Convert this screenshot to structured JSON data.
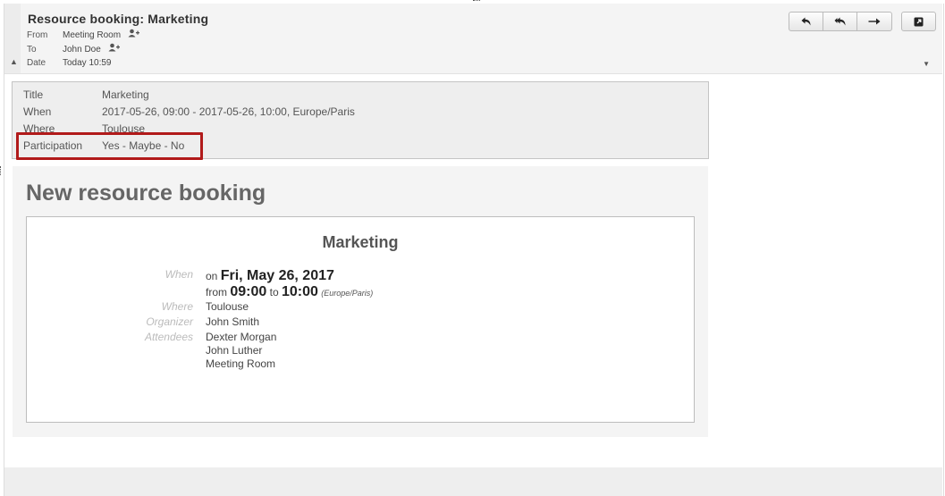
{
  "header": {
    "subject": "Resource booking: Marketing",
    "from_label": "From",
    "from_value": "Meeting Room",
    "to_label": "To",
    "to_value": "John Doe",
    "date_label": "Date",
    "date_value": "Today 10:59"
  },
  "toolbar": {
    "reply_icon": "reply-icon",
    "reply_all_icon": "reply-all-icon",
    "forward_icon": "forward-icon",
    "open_window_icon": "open-window-icon"
  },
  "event_summary": {
    "title_label": "Title",
    "title_value": "Marketing",
    "when_label": "When",
    "when_value": "2017-05-26, 09:00 - 2017-05-26, 10:00, Europe/Paris",
    "where_label": "Where",
    "where_value": "Toulouse",
    "participation_label": "Participation",
    "participation_value": "Yes - Maybe - No",
    "highlight_color": "#b11a1a"
  },
  "message": {
    "heading": "New resource booking",
    "card_title": "Marketing",
    "when_label": "When",
    "on_word": "on",
    "date": "Fri, May 26, 2017",
    "from_word": "from",
    "start_time": "09:00",
    "to_word": "to",
    "end_time": "10:00",
    "timezone": "(Europe/Paris)",
    "where_label": "Where",
    "where_value": "Toulouse",
    "organizer_label": "Organizer",
    "organizer_value": "John Smith",
    "attendees_label": "Attendees",
    "attendees": [
      "Dexter Morgan",
      "John Luther",
      "Meeting Room"
    ]
  }
}
